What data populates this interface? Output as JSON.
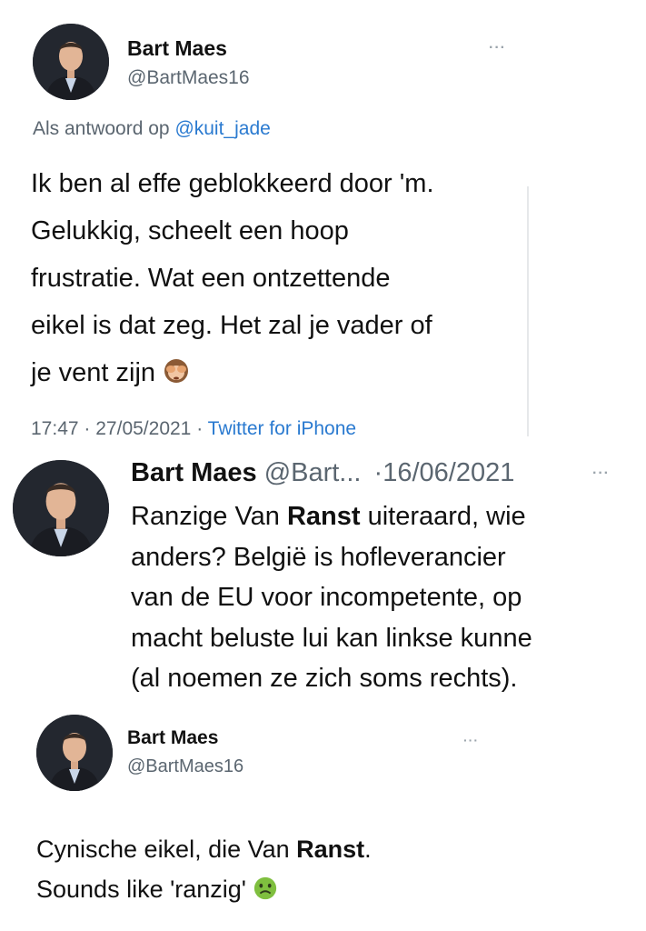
{
  "tweet1": {
    "name": "Bart Maes",
    "handle": "@BartMaes16",
    "more": "···",
    "reply_prefix": "Als antwoord op",
    "reply_to": "@kuit_jade",
    "lines": [
      "Ik ben al effe geblokkeerd door 'm.",
      "Gelukkig, scheelt een hoop",
      "frustratie. Wat een ontzettende",
      "eikel is dat zeg. Het zal je vader of",
      "je vent zijn"
    ],
    "emoji": "see-no-evil-monkey",
    "time": "17:47",
    "sep1": "·",
    "date": "27/05/2021",
    "sep2": "·",
    "source": "Twitter for iPhone"
  },
  "tweet2": {
    "name": "Bart Maes",
    "handle": "@Bart...",
    "date": "·16/06/2021",
    "more": "···",
    "line1_a": "Ranzige Van ",
    "line1_b": "Ranst",
    "line1_c": " uiteraard, wie",
    "lines": [
      "anders? België is hofleverancier",
      "van de EU voor incompetente, op",
      "macht beluste lui kan linkse kunne",
      "(al noemen ze zich soms rechts)."
    ]
  },
  "tweet3": {
    "name": "Bart Maes",
    "handle": "@BartMaes16",
    "more": "···",
    "line1_a": "Cynische eikel, die Van ",
    "line1_b": "Ranst",
    "line1_c": ".",
    "line2": "Sounds like 'ranzig'",
    "emoji": "nauseated-face"
  },
  "colors": {
    "link": "#2a7ad0",
    "meta": "#5b6670",
    "text": "#111111",
    "avatar_bg": "#20242c"
  }
}
